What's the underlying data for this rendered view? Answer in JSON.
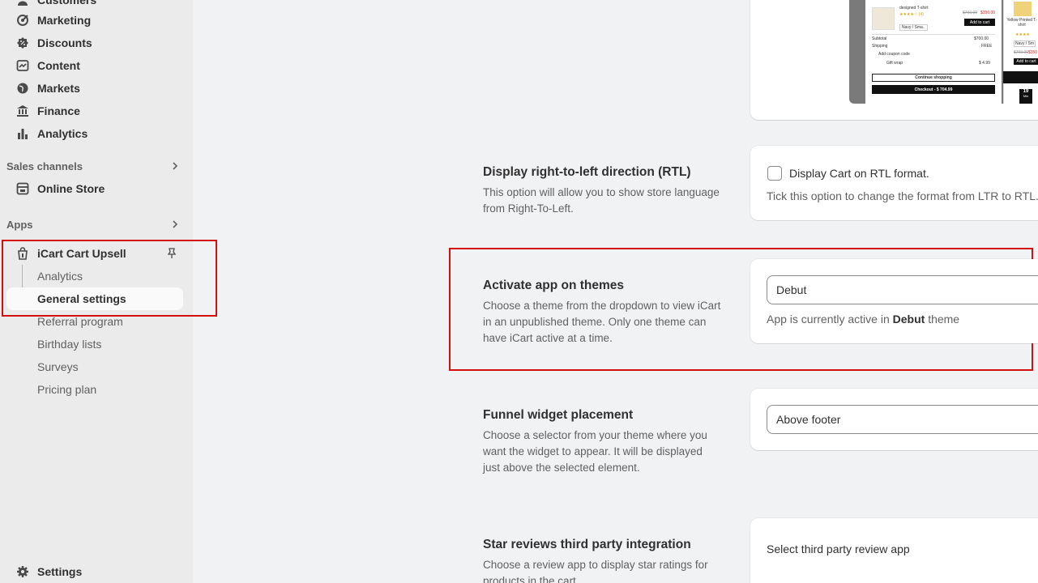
{
  "sidebar": {
    "nav": [
      {
        "label": "Customers",
        "icon": "person-icon"
      },
      {
        "label": "Marketing",
        "icon": "target-icon"
      },
      {
        "label": "Discounts",
        "icon": "discount-icon"
      },
      {
        "label": "Content",
        "icon": "content-icon"
      },
      {
        "label": "Markets",
        "icon": "globe-icon"
      },
      {
        "label": "Finance",
        "icon": "bank-icon"
      },
      {
        "label": "Analytics",
        "icon": "bar-chart-icon"
      }
    ],
    "sales_channels_label": "Sales channels",
    "online_store_label": "Online Store",
    "apps_label": "Apps",
    "app_name": "iCart Cart Upsell",
    "app_subitems": [
      "Analytics",
      "General settings",
      "Referral program",
      "Birthday lists",
      "Surveys",
      "Pricing plan"
    ],
    "settings_label": "Settings"
  },
  "main": {
    "rtl": {
      "title": "Display right-to-left direction (RTL)",
      "description": "This option will allow you to show store language from Right-To-Left.",
      "checkbox_label": "Display Cart on RTL format.",
      "help": "Tick this option to change the format from LTR to RTL."
    },
    "themes": {
      "title": "Activate app on themes",
      "description": "Choose a theme from the dropdown to view iCart in an unpublished theme. Only one theme can have iCart active at a time.",
      "selected": "Debut",
      "help_prefix": "App is currently active in",
      "help_theme": "Debut",
      "help_suffix": "theme"
    },
    "funnel": {
      "title": "Funnel widget placement",
      "description": "Choose a selector from your theme where you want the widget to appear. It will be displayed just above the selected element.",
      "selected": "Above footer"
    },
    "reviews": {
      "title": "Star reviews third party integration",
      "description": "Choose a review app to display star ratings for products in the cart.",
      "placeholder": "Select third party review app"
    }
  },
  "preview": {
    "product_name": "designed T-shirt",
    "old_price": "$700.00",
    "new_price": "$350.00",
    "variant": "Navy / Sma..",
    "add_to_cart": "Add to cart",
    "subtotal_label": "Subtotal",
    "subtotal_value": "$700.00",
    "shipping_label": "Shipping",
    "shipping_value": "FREE",
    "coupon_label": "Add coupon code",
    "gift_label": "Gift wrap",
    "gift_value": "$ 4.99",
    "continue_label": "Continue shopping",
    "checkout_label": "Checkout - $ 704.99",
    "side_product": "Yellow Printed T-shirt",
    "side_old": "$700.00",
    "side_new": "$350",
    "side_variant": "Navy / Sm",
    "side_add": "Add to cart",
    "countdown": "19",
    "countdown_unit": "Min"
  },
  "colors": {
    "highlight": "#d40f0f",
    "sidebar_bg": "#ebebeb",
    "page_bg": "#f1f2f4"
  }
}
